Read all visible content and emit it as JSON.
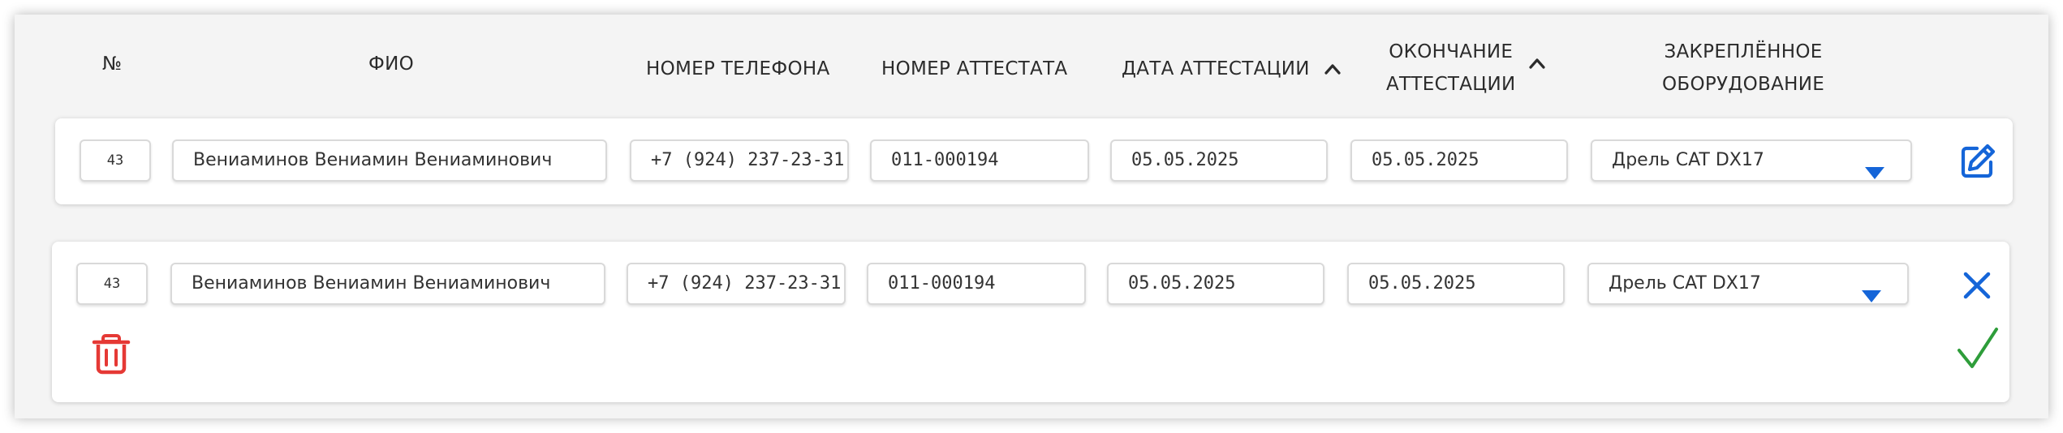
{
  "headers": {
    "num": "№",
    "fio": "ФИО",
    "phone": "НОМЕР ТЕЛЕФОНА",
    "cert_number": "НОМЕР АТТЕСТАТА",
    "cert_date": "ДАТА АТТЕСТАЦИИ",
    "cert_end_line1": "ОКОНЧАНИЕ",
    "cert_end_line2": "АТТЕСТАЦИИ",
    "equipment_line1": "ЗАКРЕПЛЁННОЕ",
    "equipment_line2": "ОБОРУДОВАНИЕ"
  },
  "rows": [
    {
      "num": "43",
      "fio": "Вениаминов Вениамин Вениаминович",
      "phone": "+7 (924) 237-23-31",
      "cert_number": "011-000194",
      "cert_date": "05.05.2025",
      "cert_end": "05.05.2025",
      "equipment": "Дрель CAT DX17"
    },
    {
      "num": "43",
      "fio": "Вениаминов Вениамин Вениаминович",
      "phone": "+7 (924) 237-23-31",
      "cert_number": "011-000194",
      "cert_date": "05.05.2025",
      "cert_end": "05.05.2025",
      "equipment": "Дрель CAT DX17"
    }
  ],
  "colors": {
    "accent_blue": "#1565d8",
    "confirm_green": "#2e9d3a",
    "delete_red": "#e53935"
  },
  "icons": {
    "sort": "chevron-up-icon",
    "dropdown": "triangle-down-icon",
    "edit": "edit-icon",
    "cancel": "close-icon",
    "confirm": "check-icon",
    "delete": "trash-icon"
  }
}
